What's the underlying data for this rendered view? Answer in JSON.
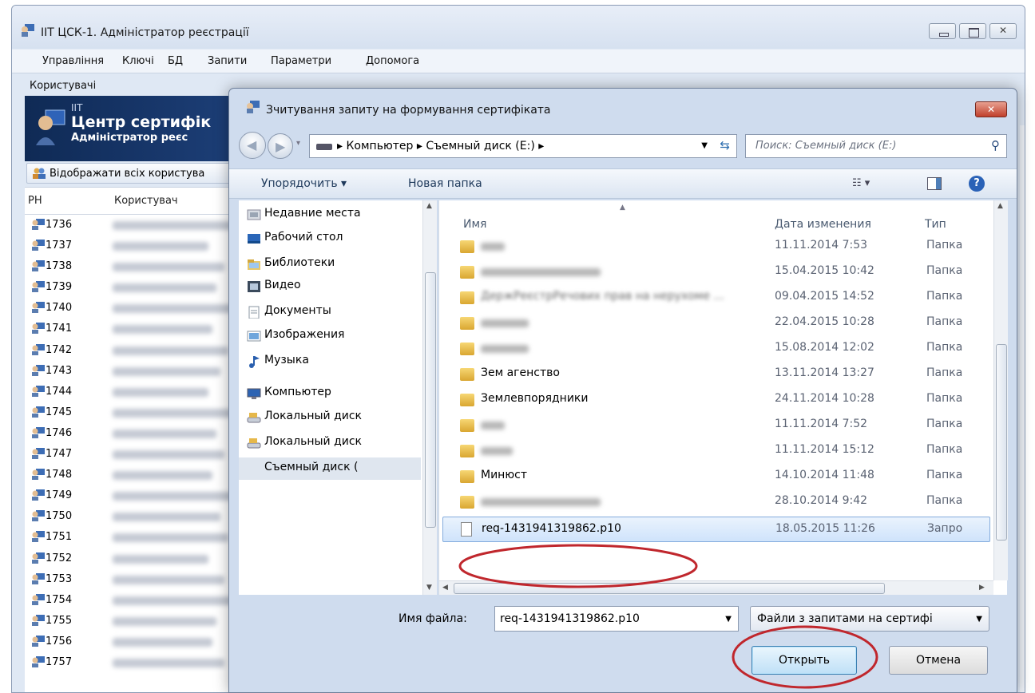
{
  "main_window": {
    "title": "IIT ЦСК-1. Адміністратор реєстрації",
    "menu": [
      "Управління",
      "Ключі",
      "БД",
      "Запити",
      "Параметри",
      "Допомога"
    ],
    "users_label": "Користувачі",
    "banner": {
      "iit": "IIT",
      "title": "Центр сертифік",
      "subtitle": "Адміністратор реєс"
    },
    "show_all_button": "Відображати всіх користува",
    "list_headers": {
      "rn": "РН",
      "user": "Користувач"
    },
    "user_rows": [
      "1736",
      "1737",
      "1738",
      "1739",
      "1740",
      "1741",
      "1742",
      "1743",
      "1744",
      "1745",
      "1746",
      "1747",
      "1748",
      "1749",
      "1750",
      "1751",
      "1752",
      "1753",
      "1754",
      "1755",
      "1756",
      "1757"
    ]
  },
  "dialog": {
    "title": "Зчитування запиту на формування сертифіката",
    "breadcrumb": "▸ Компьютер ▸ Съемный диск (E:) ▸",
    "search_placeholder": "Поиск: Съемный диск (E:)",
    "toolbar": {
      "organize": "Упорядочить ▾",
      "new_folder": "Новая папка",
      "views": "☷ ▾"
    },
    "nav": [
      {
        "label": "Недавние места",
        "icon": "recent-places-icon"
      },
      {
        "label": "Рабочий стол",
        "icon": "desktop-icon"
      },
      {
        "label": "Библиотеки",
        "icon": "libraries-icon"
      },
      {
        "label": "Видео",
        "icon": "video-icon"
      },
      {
        "label": "Документы",
        "icon": "documents-icon"
      },
      {
        "label": "Изображения",
        "icon": "images-icon"
      },
      {
        "label": "Музыка",
        "icon": "music-icon"
      },
      {
        "label": "Компьютер",
        "icon": "computer-icon"
      },
      {
        "label": "Локальный диск",
        "icon": "local-disk-icon"
      },
      {
        "label": "Локальный диск",
        "icon": "local-disk-icon"
      },
      {
        "label": "Съемный диск (",
        "icon": "removable-disk-icon"
      }
    ],
    "columns": {
      "name": "Имя",
      "date": "Дата изменения",
      "type": "Тип"
    },
    "files": [
      {
        "name": "",
        "date": "11.11.2014 7:53",
        "type": "Папка"
      },
      {
        "name": "",
        "date": "15.04.2015 10:42",
        "type": "Папка"
      },
      {
        "name": "",
        "date": "09.04.2015 14:52",
        "type": "Папка"
      },
      {
        "name": "",
        "date": "22.04.2015 10:28",
        "type": "Папка"
      },
      {
        "name": "",
        "date": "15.08.2014 12:02",
        "type": "Папка"
      },
      {
        "name": "Зем агенство",
        "date": "13.11.2014 13:27",
        "type": "Папка"
      },
      {
        "name": "Землевпорядники",
        "date": "24.11.2014 10:28",
        "type": "Папка"
      },
      {
        "name": "",
        "date": "11.11.2014 7:52",
        "type": "Папка"
      },
      {
        "name": "",
        "date": "11.11.2014 15:12",
        "type": "Папка"
      },
      {
        "name": "Минюст",
        "date": "14.10.2014 11:48",
        "type": "Папка"
      },
      {
        "name": "",
        "date": "28.10.2014 9:42",
        "type": "Папка"
      },
      {
        "name": "req-1431941319862.p10",
        "date": "18.05.2015 11:26",
        "type": "Запро"
      }
    ],
    "blurred_folder_snippet": "ДержРеєстрРечових прав на нерухоме ...",
    "filename_label": "Имя файла:",
    "filename_value": "req-1431941319862.p10",
    "filetype_value": "Файли з запитами на сертифі",
    "open_button": "Открыть",
    "cancel_button": "Отмена"
  },
  "colors": {
    "annotation": "#c0272d",
    "banner": "#0f2a55",
    "selection": "#cfe3fb"
  }
}
